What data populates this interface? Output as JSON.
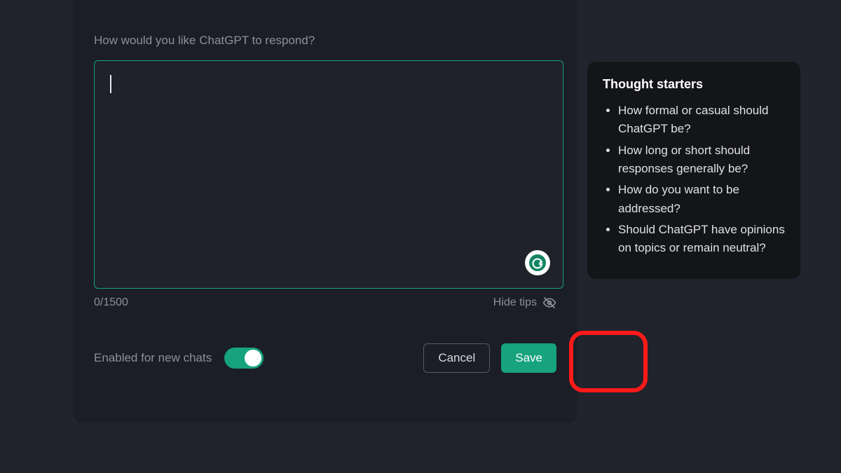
{
  "prompt_label": "How would you like ChatGPT to respond?",
  "textarea_value": "",
  "counter": "0/1500",
  "hide_tips_label": "Hide tips",
  "enabled_label": "Enabled for new chats",
  "toggle_on": true,
  "buttons": {
    "cancel": "Cancel",
    "save": "Save"
  },
  "tips": {
    "title": "Thought starters",
    "items": [
      "How formal or casual should ChatGPT be?",
      "How long or short should responses generally be?",
      "How do you want to be addressed?",
      "Should ChatGPT have opinions on topics or remain neutral?"
    ]
  }
}
